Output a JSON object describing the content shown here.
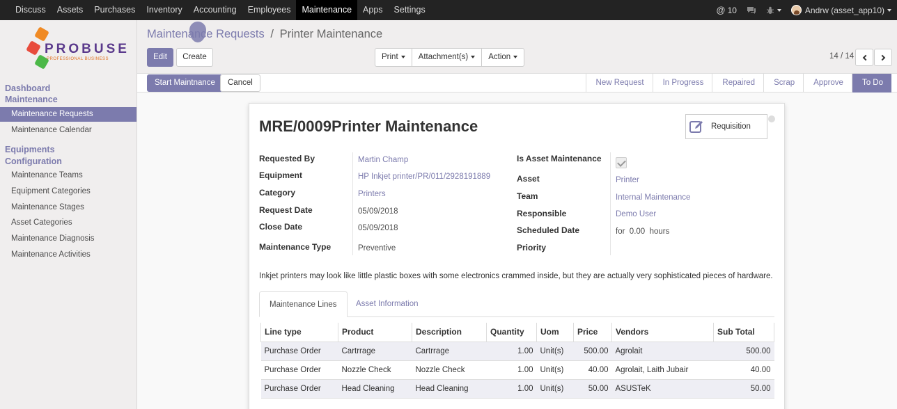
{
  "topbar": {
    "menu": [
      "Discuss",
      "Assets",
      "Purchases",
      "Inventory",
      "Accounting",
      "Employees",
      "Maintenance",
      "Apps",
      "Settings"
    ],
    "active": "Maintenance",
    "mentions_count": "10",
    "user": "Andrw (asset_app10)"
  },
  "logo": {
    "name": "PROBUSE",
    "tagline": "PROFESSIONAL BUSINESS"
  },
  "sidebar": {
    "section1": "Dashboard",
    "section2": "Maintenance",
    "items1": [
      "Maintenance Requests",
      "Maintenance Calendar"
    ],
    "section3": "Equipments",
    "section4": "Configuration",
    "items2": [
      "Maintenance Teams",
      "Equipment Categories",
      "Maintenance Stages",
      "Asset Categories",
      "Maintenance Diagnosis",
      "Maintenance Activities"
    ]
  },
  "breadcrumb": {
    "parent": "Maintenance Requests",
    "sep": "/",
    "current": "Printer Maintenance"
  },
  "controls": {
    "edit": "Edit",
    "create": "Create",
    "print": "Print",
    "attachments": "Attachment(s)",
    "action": "Action",
    "pager": "14 / 14"
  },
  "statusbar": {
    "start": "Start Maintnance",
    "cancel": "Cancel",
    "stages": [
      "New Request",
      "In Progress",
      "Repaired",
      "Scrap",
      "Approve",
      "To Do"
    ],
    "active_stage": "To Do"
  },
  "form": {
    "title": "MRE/0009Printer Maintenance",
    "requisition": "Requisition",
    "left": [
      {
        "label": "Requested By",
        "value": "Martin Champ"
      },
      {
        "label": "Equipment",
        "value": "HP Inkjet printer/PR/011/2928191889"
      },
      {
        "label": "Category",
        "value": "Printers"
      },
      {
        "label": "Request Date",
        "value": "05/09/2018"
      },
      {
        "label": "Close Date",
        "value": "05/09/2018"
      },
      {
        "label": "Maintenance Type",
        "value": "Preventive"
      }
    ],
    "right": [
      {
        "label": "Is Asset Maintenance",
        "value": ""
      },
      {
        "label": "Asset",
        "value": "Printer"
      },
      {
        "label": "Team",
        "value": "Internal Maintenance"
      },
      {
        "label": "Responsible",
        "value": "Demo User"
      },
      {
        "label": "Scheduled Date",
        "value": "for  0.00  hours"
      },
      {
        "label": "Priority",
        "value": ""
      }
    ],
    "is_asset_maintenance": true,
    "description": "Inkjet printers may look like little plastic boxes with some electronics crammed inside, but they are actually very sophisticated pieces of hardware."
  },
  "tabs": [
    "Maintenance Lines",
    "Asset Information"
  ],
  "lines": {
    "headers": [
      "Line type",
      "Product",
      "Description",
      "Quantity",
      "Uom",
      "Price",
      "Vendors",
      "Sub Total"
    ],
    "rows": [
      [
        "Purchase Order",
        "Cartrrage",
        "Cartrrage",
        "1.00",
        "Unit(s)",
        "500.00",
        "Agrolait",
        "500.00"
      ],
      [
        "Purchase Order",
        "Nozzle Check",
        "Nozzle Check",
        "1.00",
        "Unit(s)",
        "40.00",
        "Agrolait, Laith Jubair",
        "40.00"
      ],
      [
        "Purchase Order",
        "Head Cleaning",
        "Head Cleaning",
        "1.00",
        "Unit(s)",
        "50.00",
        "ASUSTeK",
        "50.00"
      ]
    ]
  },
  "colors": {
    "accent": "#7c7bad",
    "topbar": "#232323"
  }
}
